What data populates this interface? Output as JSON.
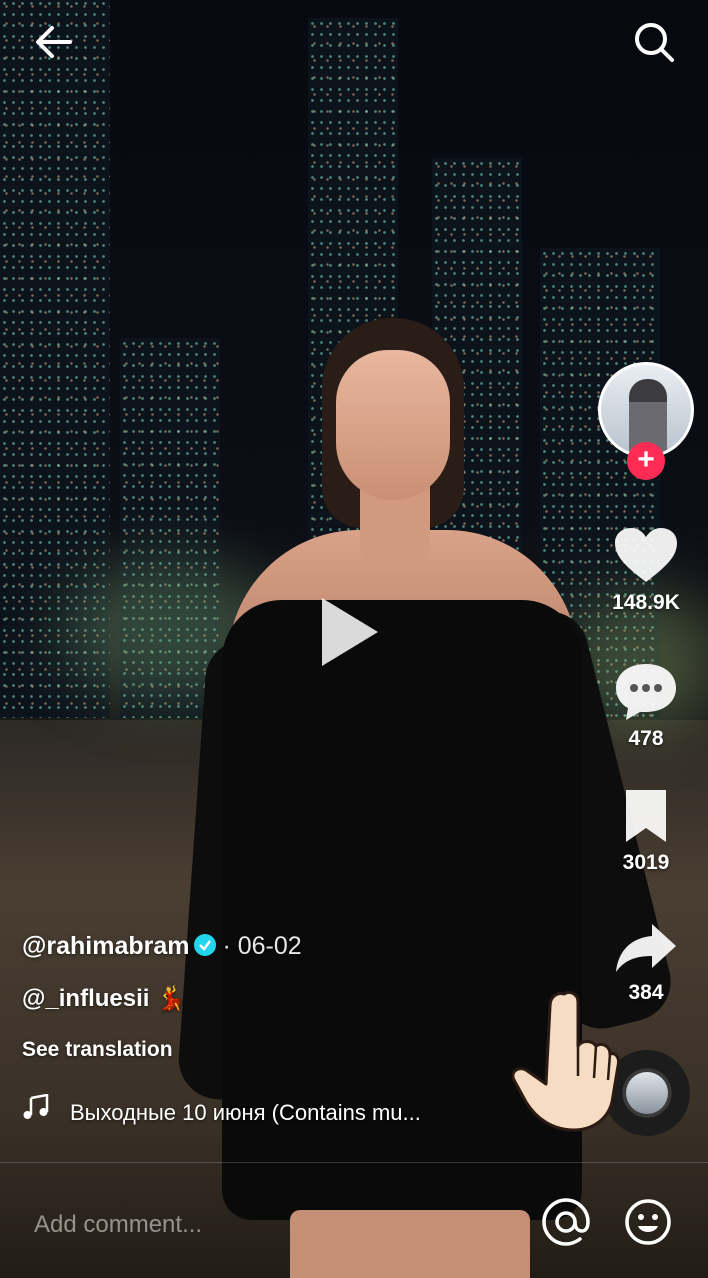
{
  "header": {
    "back_icon": "arrow-left-icon",
    "search_icon": "search-icon"
  },
  "player": {
    "state_icon": "play-icon"
  },
  "creator": {
    "avatar_icon": "avatar",
    "follow_label": "+"
  },
  "actions": {
    "likes": "148.9K",
    "comments": "478",
    "bookmarks": "3019",
    "shares": "384"
  },
  "post": {
    "username": "@rahimabram",
    "date": "· 06-02",
    "caption": "@_influesii 💃",
    "see_translation": "See translation",
    "music_title": "Выходные 10 июня (Contains mu..."
  },
  "comment_bar": {
    "placeholder": "Add comment..."
  },
  "colors": {
    "follow_badge": "#fe2c55",
    "verified_badge": "#20d5ec"
  }
}
